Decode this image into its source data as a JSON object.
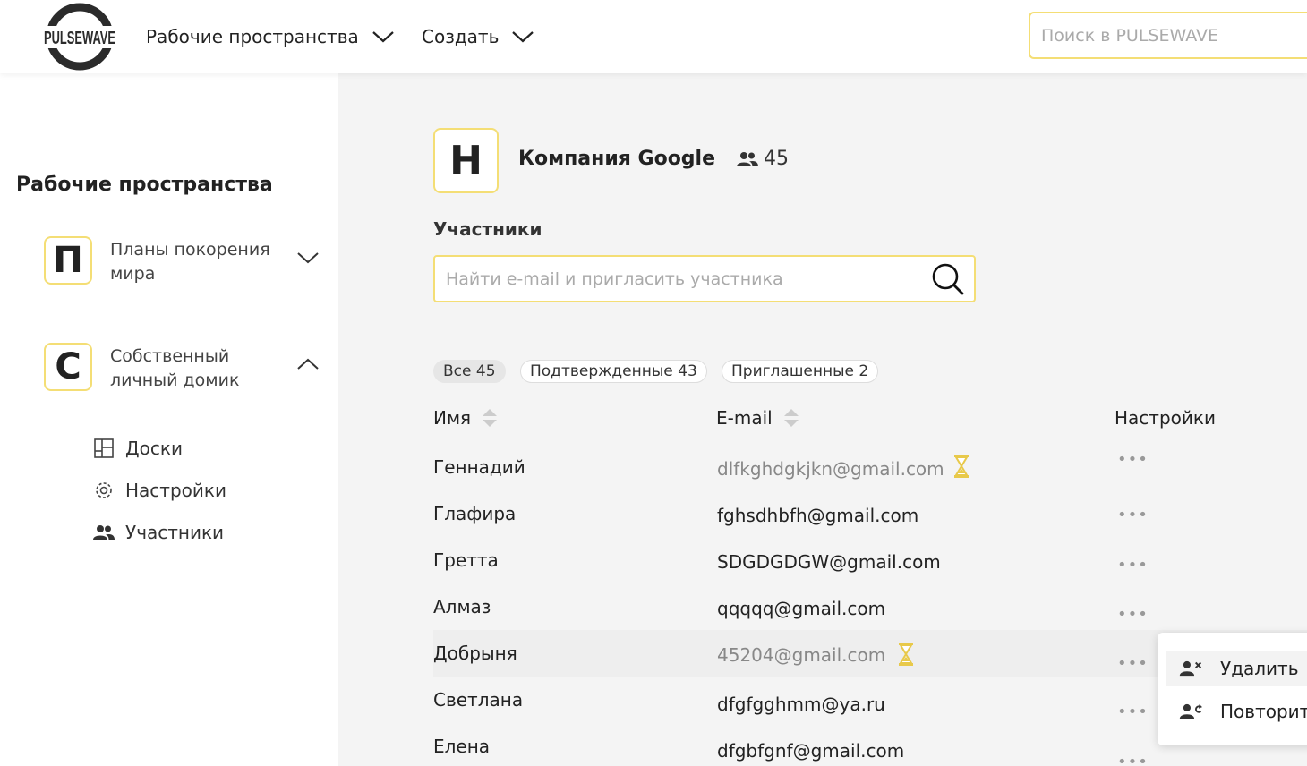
{
  "header": {
    "logo_text": "PULSEWAVE",
    "nav": [
      {
        "label": "Рабочие пространства"
      },
      {
        "label": "Создать"
      }
    ],
    "search_placeholder": "Поиск в PULSEWAVE"
  },
  "sidebar": {
    "title": "Рабочие пространства",
    "workspaces": [
      {
        "letter": "П",
        "name": "Планы покорения мира",
        "expanded": false
      },
      {
        "letter": "С",
        "name": "Собственный личный домик",
        "expanded": true
      }
    ],
    "subitems": [
      {
        "label": "Доски",
        "icon": "boards-icon"
      },
      {
        "label": "Настройки",
        "icon": "gear-icon"
      },
      {
        "label": "Участники",
        "icon": "users-icon"
      }
    ]
  },
  "company": {
    "letter": "H",
    "name": "Компания Google",
    "member_count": "45"
  },
  "members": {
    "title": "Участники",
    "search_placeholder": "Найти e-mail и пригласить участника",
    "filters": [
      {
        "label": "Все 45",
        "active": true
      },
      {
        "label": "Подтвержденные 43",
        "active": false
      },
      {
        "label": "Приглашенные 2",
        "active": false
      }
    ],
    "columns": {
      "name": "Имя",
      "email": "E-mail",
      "settings": "Настройки"
    },
    "rows": [
      {
        "name": "Геннадий",
        "email": "dlfkghdgkjkn@gmail.com",
        "pending": true
      },
      {
        "name": "Глафира",
        "email": "fghsdhbfh@gmail.com",
        "pending": false
      },
      {
        "name": "Гретта",
        "email": "SDGDGDGW@gmail.com",
        "pending": false
      },
      {
        "name": "Алмаз",
        "email": "qqqqq@gmail.com",
        "pending": false
      },
      {
        "name": "Добрыня",
        "email": "45204@gmail.com",
        "pending": true
      },
      {
        "name": "Светлана",
        "email": "dfgfgghmm@ya.ru",
        "pending": false
      },
      {
        "name": "Елена",
        "email": "dfgbfgnf@gmail.com",
        "pending": false
      }
    ],
    "more_label": "•••"
  },
  "context_menu": {
    "items": [
      {
        "label": "Удалить",
        "icon": "remove-user-icon"
      },
      {
        "label": "Повторить",
        "icon": "resend-invite-icon"
      }
    ]
  },
  "colors": {
    "accent": "#f4de75",
    "pending_icon": "#e8c94a"
  }
}
